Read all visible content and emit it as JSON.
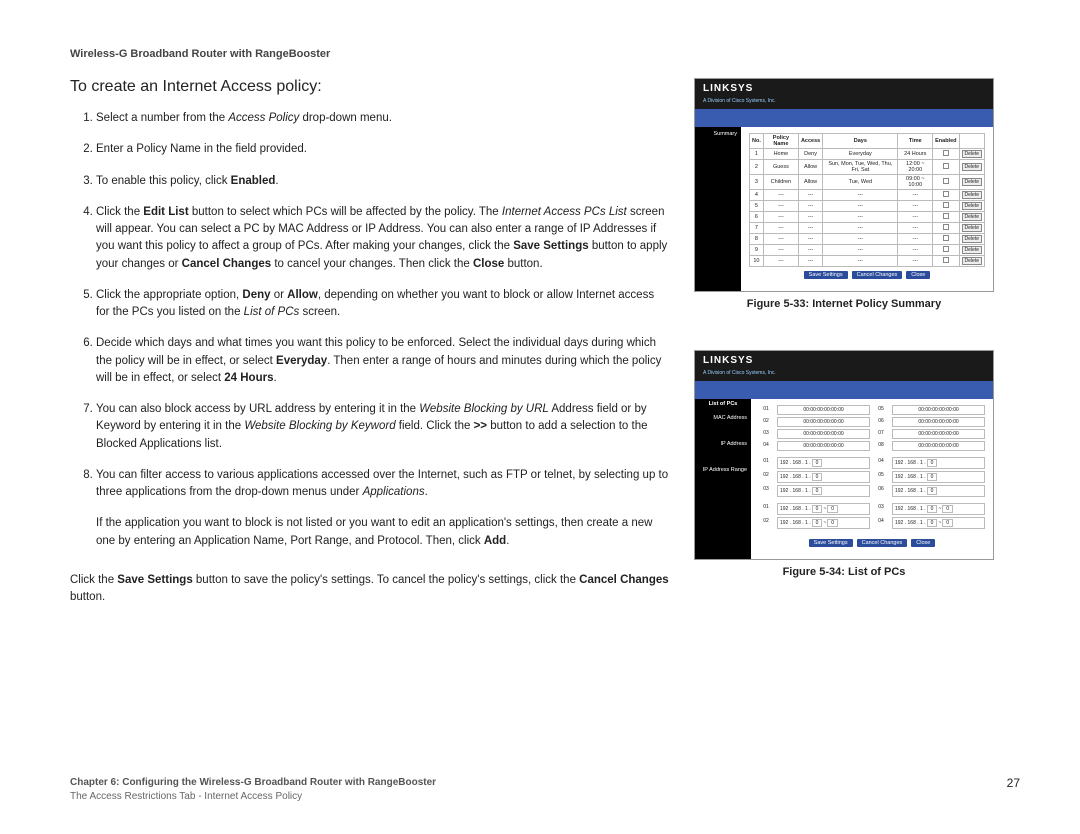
{
  "header": "Wireless-G Broadband Router with RangeBooster",
  "heading": "To create an Internet Access policy:",
  "steps": {
    "s1a": "Select a number from the ",
    "s1b": "Access Policy",
    "s1c": " drop-down menu.",
    "s2": "Enter a Policy Name in the field provided.",
    "s3a": "To enable this policy, click ",
    "s3b": "Enabled",
    "s3c": ".",
    "s4a": "Click the ",
    "s4b": "Edit List",
    "s4c": " button to select which PCs will be affected by the policy. The ",
    "s4d": "Internet Access PCs List",
    "s4e": " screen will appear. You can select a PC by MAC Address or IP Address. You can also enter a range of IP Addresses if you want this policy to affect a group of PCs. After making your changes, click the ",
    "s4f": "Save Settings",
    "s4g": " button to apply your changes or ",
    "s4h": "Cancel Changes",
    "s4i": " to cancel your changes. Then click the ",
    "s4j": "Close",
    "s4k": " button.",
    "s5a": "Click the appropriate option, ",
    "s5b": "Deny",
    "s5c": " or ",
    "s5d": "Allow",
    "s5e": ", depending on whether you want to block or allow Internet access for the PCs you listed on the ",
    "s5f": "List of PCs",
    "s5g": " screen.",
    "s6a": "Decide which days and what times you want this policy to be enforced. Select the individual days during which the policy will be in effect, or select ",
    "s6b": "Everyday",
    "s6c": ". Then enter a range of hours and minutes during which the policy will be in effect, or select ",
    "s6d": "24 Hours",
    "s6e": ".",
    "s7a": "You can also block access by URL address by entering it in the ",
    "s7b": "Website Blocking by URL",
    "s7c": " Address field or by Keyword by entering it in the ",
    "s7d": "Website Blocking by Keyword",
    "s7e": " field. Click the ",
    "s7f": ">>",
    "s7g": " button to add a selection to the Blocked Applications list.",
    "s8a": "You can filter access to various applications accessed over the Internet, such as FTP or telnet, by selecting up to three applications from the drop-down menus under ",
    "s8b": "Applications",
    "s8c": "."
  },
  "para1a": "If the application you want to block is not listed or you want to edit an application's settings, then create a new one by entering an Application Name, Port Range, and Protocol. Then, click ",
  "para1b": "Add",
  "para1c": ".",
  "para2a": "Click the ",
  "para2b": "Save Settings",
  "para2c": " button to save the policy's settings. To cancel the policy's settings, click the ",
  "para2d": "Cancel Changes",
  "para2e": " button.",
  "fig33": {
    "caption": "Figure 5-33: Internet Policy Summary",
    "brand": "LINKSYS",
    "brandsub": "A Division of Cisco Systems, Inc.",
    "sidelabel": "Summary",
    "cols": [
      "No.",
      "Policy Name",
      "Access",
      "Days",
      "Time",
      "Enabled",
      ""
    ],
    "rows": [
      [
        "1",
        "Home",
        "Deny",
        "Everyday",
        "24 Hours"
      ],
      [
        "2",
        "Guess",
        "Allow",
        "Sun, Mon, Tue, Wed, Thu, Fri, Sat",
        "12:00 ~ 20:00"
      ],
      [
        "3",
        "Children",
        "Allow",
        "Tue, Wed",
        "09:00 ~ 10:00"
      ],
      [
        "4",
        "---",
        "---",
        "---",
        "---"
      ],
      [
        "5",
        "---",
        "---",
        "---",
        "---"
      ],
      [
        "6",
        "---",
        "---",
        "---",
        "---"
      ],
      [
        "7",
        "---",
        "---",
        "---",
        "---"
      ],
      [
        "8",
        "---",
        "---",
        "---",
        "---"
      ],
      [
        "9",
        "---",
        "---",
        "---",
        "---"
      ],
      [
        "10",
        "---",
        "---",
        "---",
        "---"
      ]
    ],
    "delete": "Delete",
    "buttons": [
      "Save Settings",
      "Cancel Changes",
      "Close"
    ]
  },
  "fig34": {
    "caption": "Figure 5-34: List of PCs",
    "brand": "LINKSYS",
    "brandsub": "A Division of Cisco Systems, Inc.",
    "title": "List of PCs",
    "lbl_mac": "MAC Address",
    "lbl_ip": "IP Address",
    "lbl_range": "IP Address Range",
    "mac_nums_left": [
      "01",
      "02",
      "03",
      "04"
    ],
    "mac_nums_right": [
      "05",
      "06",
      "07",
      "08"
    ],
    "mac_val": "00:00:00:00:00:00",
    "ip_nums_left": [
      "01",
      "02",
      "03"
    ],
    "ip_nums_right": [
      "04",
      "05",
      "06"
    ],
    "ip_prefix": "192 . 168 . 1 .",
    "ip_seg": "0",
    "range_nums_left": [
      "01",
      "02"
    ],
    "range_nums_right": [
      "03",
      "04"
    ],
    "buttons": [
      "Save Settings",
      "Cancel Changes",
      "Close"
    ]
  },
  "footer": {
    "line1a": "Chapter 6: Configuring the Wireless-G Broadband Router with RangeBooster",
    "line2": "The Access Restrictions Tab - Internet Access Policy",
    "page": "27"
  }
}
